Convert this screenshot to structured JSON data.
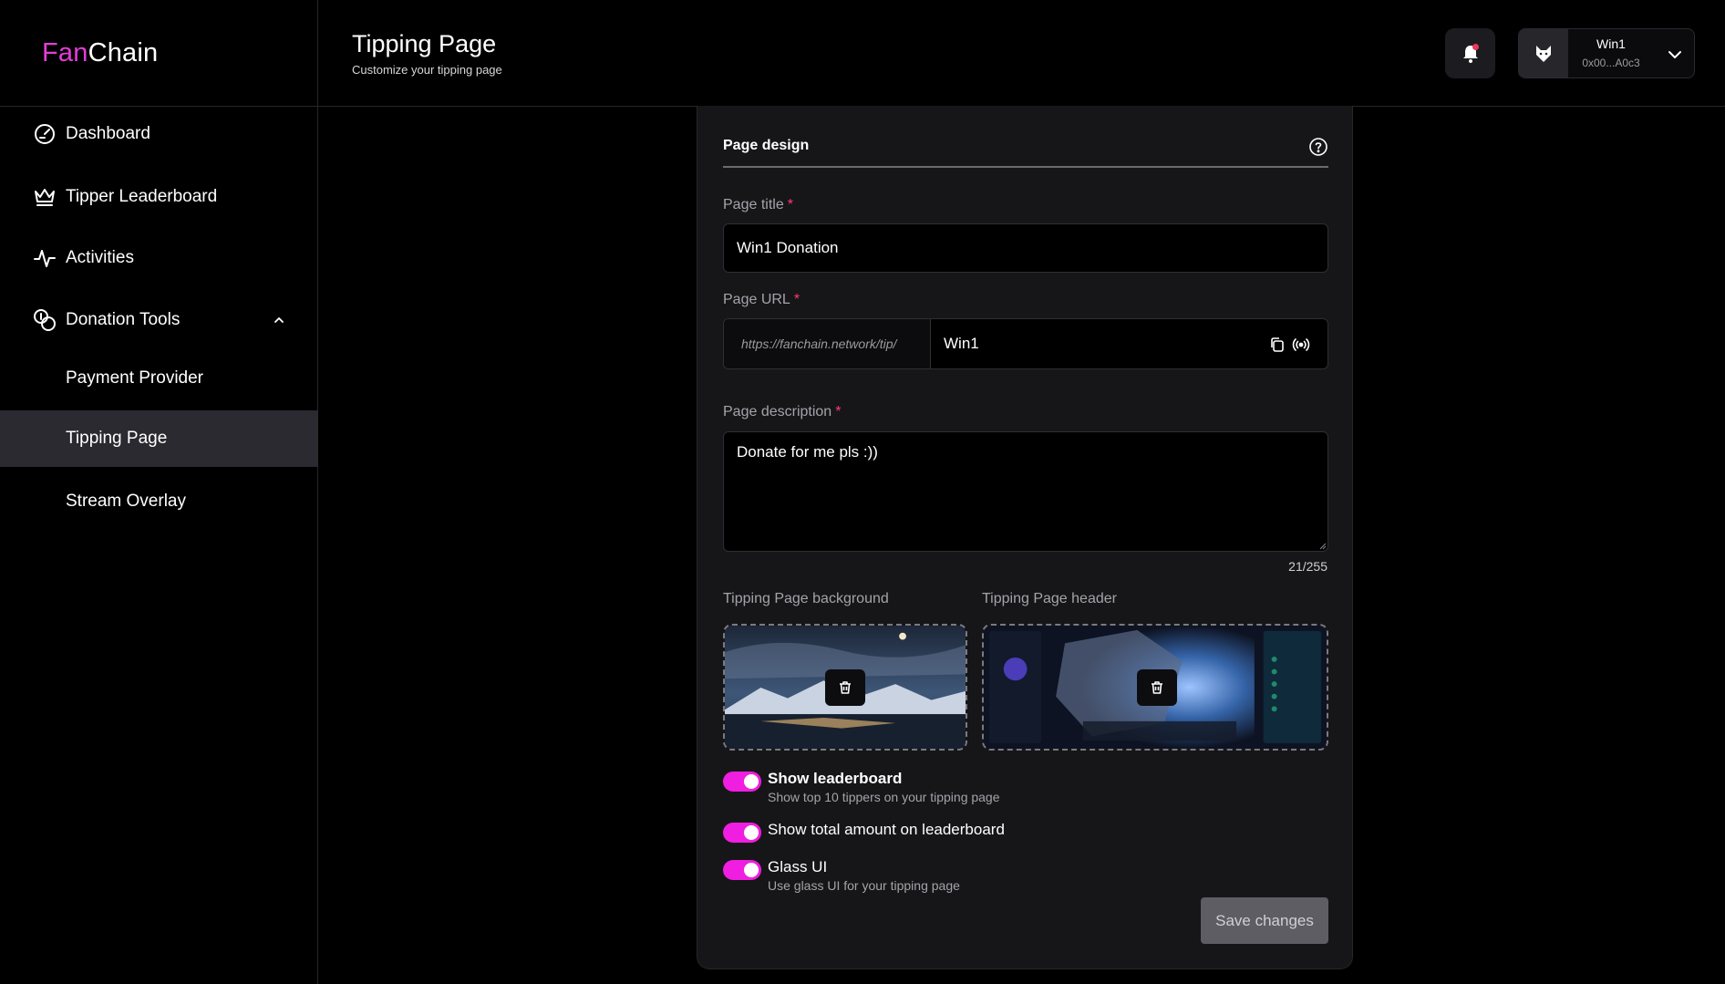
{
  "brand": {
    "part1": "Fan",
    "part2": "Chain",
    "accent": "#e53cd9"
  },
  "header": {
    "title": "Tipping Page",
    "subtitle": "Customize your tipping page",
    "user": {
      "name": "Win1",
      "address": "0x00...A0c3"
    }
  },
  "sidebar": {
    "items": [
      {
        "label": "Dashboard",
        "icon": "gauge-icon"
      },
      {
        "label": "Tipper Leaderboard",
        "icon": "crown-icon"
      },
      {
        "label": "Activities",
        "icon": "activity-icon"
      },
      {
        "label": "Donation Tools",
        "icon": "coins-icon",
        "expanded": true
      }
    ],
    "sub_items": [
      {
        "label": "Payment Provider"
      },
      {
        "label": "Tipping Page",
        "active": true
      },
      {
        "label": "Stream Overlay"
      }
    ]
  },
  "form": {
    "section_title": "Page design",
    "page_title": {
      "label": "Page title",
      "required_mark": "*",
      "value": "Win1 Donation"
    },
    "page_url": {
      "label": "Page URL",
      "required_mark": "*",
      "prefix": "https://fanchain.network/tip/",
      "value": "Win1"
    },
    "page_description": {
      "label": "Page description",
      "required_mark": "*",
      "value": "Donate for me pls :))",
      "counter": "21/255"
    },
    "background_label": "Tipping Page background",
    "header_label": "Tipping Page header",
    "toggles": [
      {
        "title": "Show leaderboard",
        "description": "Show top 10 tippers on your tipping page",
        "on": true
      },
      {
        "title": "Show total amount on leaderboard",
        "on": true
      },
      {
        "title": "Glass UI",
        "description": "Use glass UI for your tipping page",
        "on": true
      }
    ],
    "save_label": "Save changes"
  },
  "colors": {
    "toggle_on": "#f01ee0",
    "required": "#ff3b6b",
    "card": "#161619"
  }
}
